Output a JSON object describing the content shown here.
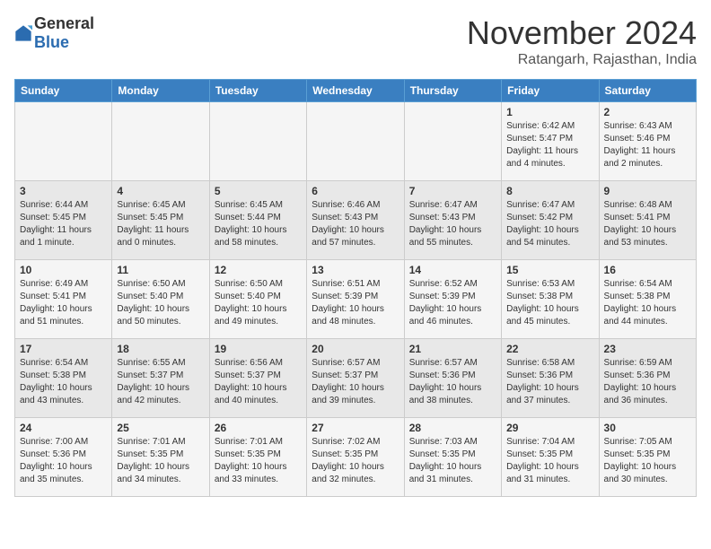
{
  "header": {
    "logo_general": "General",
    "logo_blue": "Blue",
    "month": "November 2024",
    "location": "Ratangarh, Rajasthan, India"
  },
  "weekdays": [
    "Sunday",
    "Monday",
    "Tuesday",
    "Wednesday",
    "Thursday",
    "Friday",
    "Saturday"
  ],
  "weeks": [
    [
      {
        "day": "",
        "info": ""
      },
      {
        "day": "",
        "info": ""
      },
      {
        "day": "",
        "info": ""
      },
      {
        "day": "",
        "info": ""
      },
      {
        "day": "",
        "info": ""
      },
      {
        "day": "1",
        "info": "Sunrise: 6:42 AM\nSunset: 5:47 PM\nDaylight: 11 hours\nand 4 minutes."
      },
      {
        "day": "2",
        "info": "Sunrise: 6:43 AM\nSunset: 5:46 PM\nDaylight: 11 hours\nand 2 minutes."
      }
    ],
    [
      {
        "day": "3",
        "info": "Sunrise: 6:44 AM\nSunset: 5:45 PM\nDaylight: 11 hours\nand 1 minute."
      },
      {
        "day": "4",
        "info": "Sunrise: 6:45 AM\nSunset: 5:45 PM\nDaylight: 11 hours\nand 0 minutes."
      },
      {
        "day": "5",
        "info": "Sunrise: 6:45 AM\nSunset: 5:44 PM\nDaylight: 10 hours\nand 58 minutes."
      },
      {
        "day": "6",
        "info": "Sunrise: 6:46 AM\nSunset: 5:43 PM\nDaylight: 10 hours\nand 57 minutes."
      },
      {
        "day": "7",
        "info": "Sunrise: 6:47 AM\nSunset: 5:43 PM\nDaylight: 10 hours\nand 55 minutes."
      },
      {
        "day": "8",
        "info": "Sunrise: 6:47 AM\nSunset: 5:42 PM\nDaylight: 10 hours\nand 54 minutes."
      },
      {
        "day": "9",
        "info": "Sunrise: 6:48 AM\nSunset: 5:41 PM\nDaylight: 10 hours\nand 53 minutes."
      }
    ],
    [
      {
        "day": "10",
        "info": "Sunrise: 6:49 AM\nSunset: 5:41 PM\nDaylight: 10 hours\nand 51 minutes."
      },
      {
        "day": "11",
        "info": "Sunrise: 6:50 AM\nSunset: 5:40 PM\nDaylight: 10 hours\nand 50 minutes."
      },
      {
        "day": "12",
        "info": "Sunrise: 6:50 AM\nSunset: 5:40 PM\nDaylight: 10 hours\nand 49 minutes."
      },
      {
        "day": "13",
        "info": "Sunrise: 6:51 AM\nSunset: 5:39 PM\nDaylight: 10 hours\nand 48 minutes."
      },
      {
        "day": "14",
        "info": "Sunrise: 6:52 AM\nSunset: 5:39 PM\nDaylight: 10 hours\nand 46 minutes."
      },
      {
        "day": "15",
        "info": "Sunrise: 6:53 AM\nSunset: 5:38 PM\nDaylight: 10 hours\nand 45 minutes."
      },
      {
        "day": "16",
        "info": "Sunrise: 6:54 AM\nSunset: 5:38 PM\nDaylight: 10 hours\nand 44 minutes."
      }
    ],
    [
      {
        "day": "17",
        "info": "Sunrise: 6:54 AM\nSunset: 5:38 PM\nDaylight: 10 hours\nand 43 minutes."
      },
      {
        "day": "18",
        "info": "Sunrise: 6:55 AM\nSunset: 5:37 PM\nDaylight: 10 hours\nand 42 minutes."
      },
      {
        "day": "19",
        "info": "Sunrise: 6:56 AM\nSunset: 5:37 PM\nDaylight: 10 hours\nand 40 minutes."
      },
      {
        "day": "20",
        "info": "Sunrise: 6:57 AM\nSunset: 5:37 PM\nDaylight: 10 hours\nand 39 minutes."
      },
      {
        "day": "21",
        "info": "Sunrise: 6:57 AM\nSunset: 5:36 PM\nDaylight: 10 hours\nand 38 minutes."
      },
      {
        "day": "22",
        "info": "Sunrise: 6:58 AM\nSunset: 5:36 PM\nDaylight: 10 hours\nand 37 minutes."
      },
      {
        "day": "23",
        "info": "Sunrise: 6:59 AM\nSunset: 5:36 PM\nDaylight: 10 hours\nand 36 minutes."
      }
    ],
    [
      {
        "day": "24",
        "info": "Sunrise: 7:00 AM\nSunset: 5:36 PM\nDaylight: 10 hours\nand 35 minutes."
      },
      {
        "day": "25",
        "info": "Sunrise: 7:01 AM\nSunset: 5:35 PM\nDaylight: 10 hours\nand 34 minutes."
      },
      {
        "day": "26",
        "info": "Sunrise: 7:01 AM\nSunset: 5:35 PM\nDaylight: 10 hours\nand 33 minutes."
      },
      {
        "day": "27",
        "info": "Sunrise: 7:02 AM\nSunset: 5:35 PM\nDaylight: 10 hours\nand 32 minutes."
      },
      {
        "day": "28",
        "info": "Sunrise: 7:03 AM\nSunset: 5:35 PM\nDaylight: 10 hours\nand 31 minutes."
      },
      {
        "day": "29",
        "info": "Sunrise: 7:04 AM\nSunset: 5:35 PM\nDaylight: 10 hours\nand 31 minutes."
      },
      {
        "day": "30",
        "info": "Sunrise: 7:05 AM\nSunset: 5:35 PM\nDaylight: 10 hours\nand 30 minutes."
      }
    ]
  ]
}
